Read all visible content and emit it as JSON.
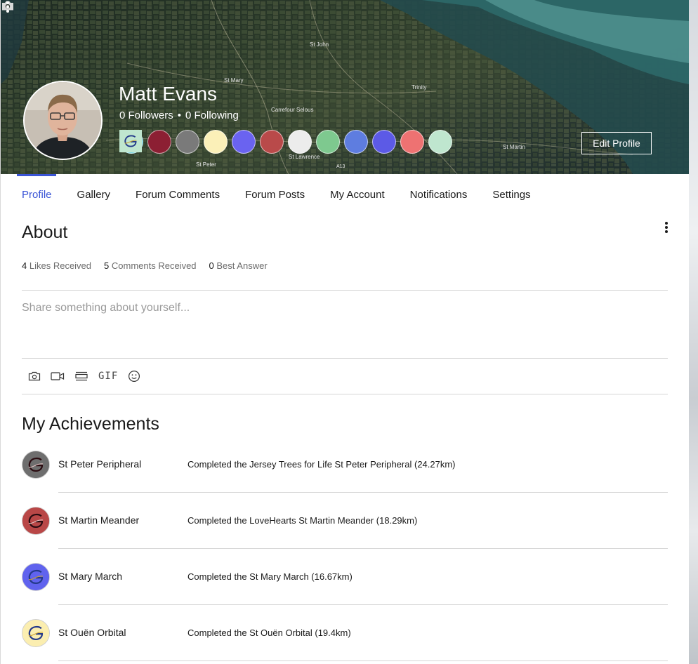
{
  "cover": {
    "map_labels": [
      "St John",
      "St Mary",
      "Trinity",
      "Carrefour Selous",
      "St Martin",
      "St Peter",
      "St Lawrence",
      "A13"
    ]
  },
  "profile": {
    "name": "Matt Evans",
    "followers_count": "0",
    "followers_label": "Followers",
    "following_count": "0",
    "following_label": "Following",
    "edit_button": "Edit Profile",
    "badge_colors": [
      "#72d5e6",
      "#8c1f33",
      "#7a7a7a",
      "#fbf0b8",
      "#6a63f0",
      "#b94a4a",
      "#ececec",
      "#7ec98f",
      "#5e7de0",
      "#5c5ae6",
      "#ee7272",
      "#bfe6cf"
    ]
  },
  "tabs": [
    {
      "label": "Profile",
      "active": true
    },
    {
      "label": "Gallery"
    },
    {
      "label": "Forum Comments"
    },
    {
      "label": "Forum Posts"
    },
    {
      "label": "My Account"
    },
    {
      "label": "Notifications"
    },
    {
      "label": "Settings"
    }
  ],
  "about": {
    "title": "About",
    "stats": [
      {
        "count": "4",
        "label": "Likes Received"
      },
      {
        "count": "5",
        "label": "Comments Received"
      },
      {
        "count": "0",
        "label": "Best Answer"
      }
    ],
    "placeholder": "Share something about yourself...",
    "toolbar": {
      "gif_label": "GIF"
    }
  },
  "achievements": {
    "title": "My Achievements",
    "items": [
      {
        "name": "St Peter Peripheral",
        "description": "Completed the Jersey Trees for Life St Peter Peripheral (24.27km)",
        "color": "#6e6e6e"
      },
      {
        "name": "St Martin Meander",
        "description": "Completed the LoveHearts St Martin Meander (18.29km)",
        "color": "#b94747"
      },
      {
        "name": "St Mary March",
        "description": "Completed the St Mary March (16.67km)",
        "color": "#6063ee"
      },
      {
        "name": "St Ouën Orbital",
        "description": "Completed the St Ouën Orbital (19.4km)",
        "color": "#fbeeb0"
      }
    ]
  },
  "icons": {
    "cover_camera": "camera-icon",
    "more": "more-vertical-icon",
    "toolbar": [
      "camera-icon",
      "video-icon",
      "divider-icon",
      "gif-icon",
      "emoji-icon"
    ]
  }
}
